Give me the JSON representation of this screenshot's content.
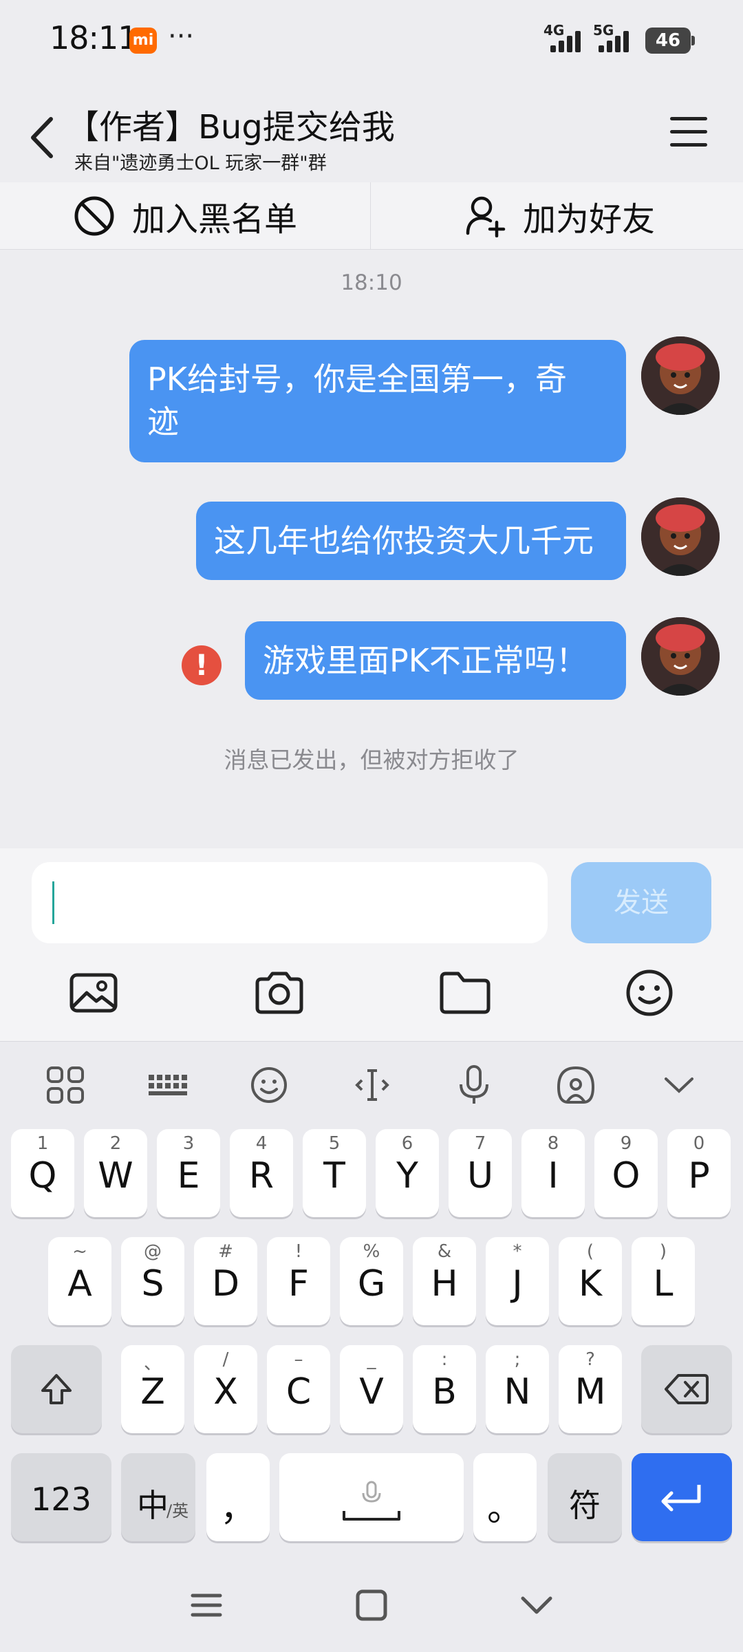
{
  "status_bar": {
    "time": "18:11",
    "app_badge": "mi",
    "more": "···",
    "net1": "4G",
    "net2": "5G",
    "battery": "46"
  },
  "header": {
    "title": "【作者】Bug提交给我",
    "subtitle": "来自\"遗迹勇士OL  玩家一群\"群"
  },
  "actions": {
    "block_label": "加入黑名单",
    "add_friend_label": "加为好友"
  },
  "chat": {
    "timestamp": "18:10",
    "messages": [
      {
        "text_line1": "PK给封号，你是全国第一，奇",
        "text_line2": "迹"
      },
      {
        "text": "这几年也给你投资大几千元"
      },
      {
        "text": "游戏里面PK不正常吗！",
        "status": "failed"
      }
    ],
    "reject_note": "消息已发出，但被对方拒收了"
  },
  "input": {
    "value": "",
    "send_label": "发送"
  },
  "toolbar_icons": [
    "image-icon",
    "camera-icon",
    "folder-icon",
    "emoji-icon"
  ],
  "keyboard": {
    "row1": [
      {
        "main": "Q",
        "sub": "1"
      },
      {
        "main": "W",
        "sub": "2"
      },
      {
        "main": "E",
        "sub": "3"
      },
      {
        "main": "R",
        "sub": "4"
      },
      {
        "main": "T",
        "sub": "5"
      },
      {
        "main": "Y",
        "sub": "6"
      },
      {
        "main": "U",
        "sub": "7"
      },
      {
        "main": "I",
        "sub": "8"
      },
      {
        "main": "O",
        "sub": "9"
      },
      {
        "main": "P",
        "sub": "0"
      }
    ],
    "row2": [
      {
        "main": "A",
        "sub": "~"
      },
      {
        "main": "S",
        "sub": "@"
      },
      {
        "main": "D",
        "sub": "#"
      },
      {
        "main": "F",
        "sub": "!"
      },
      {
        "main": "G",
        "sub": "%"
      },
      {
        "main": "H",
        "sub": "&"
      },
      {
        "main": "J",
        "sub": "*"
      },
      {
        "main": "K",
        "sub": "("
      },
      {
        "main": "L",
        "sub": ")"
      }
    ],
    "row3": [
      {
        "main": "Z",
        "sub": "、"
      },
      {
        "main": "X",
        "sub": "/"
      },
      {
        "main": "C",
        "sub": "–"
      },
      {
        "main": "V",
        "sub": "_"
      },
      {
        "main": "B",
        "sub": ":"
      },
      {
        "main": "N",
        "sub": ";"
      },
      {
        "main": "M",
        "sub": "?"
      }
    ],
    "num_key": "123",
    "lang_key": "中",
    "lang_sub": "/英",
    "comma_key": "，",
    "period_key": "。",
    "symbol_key": "符"
  }
}
